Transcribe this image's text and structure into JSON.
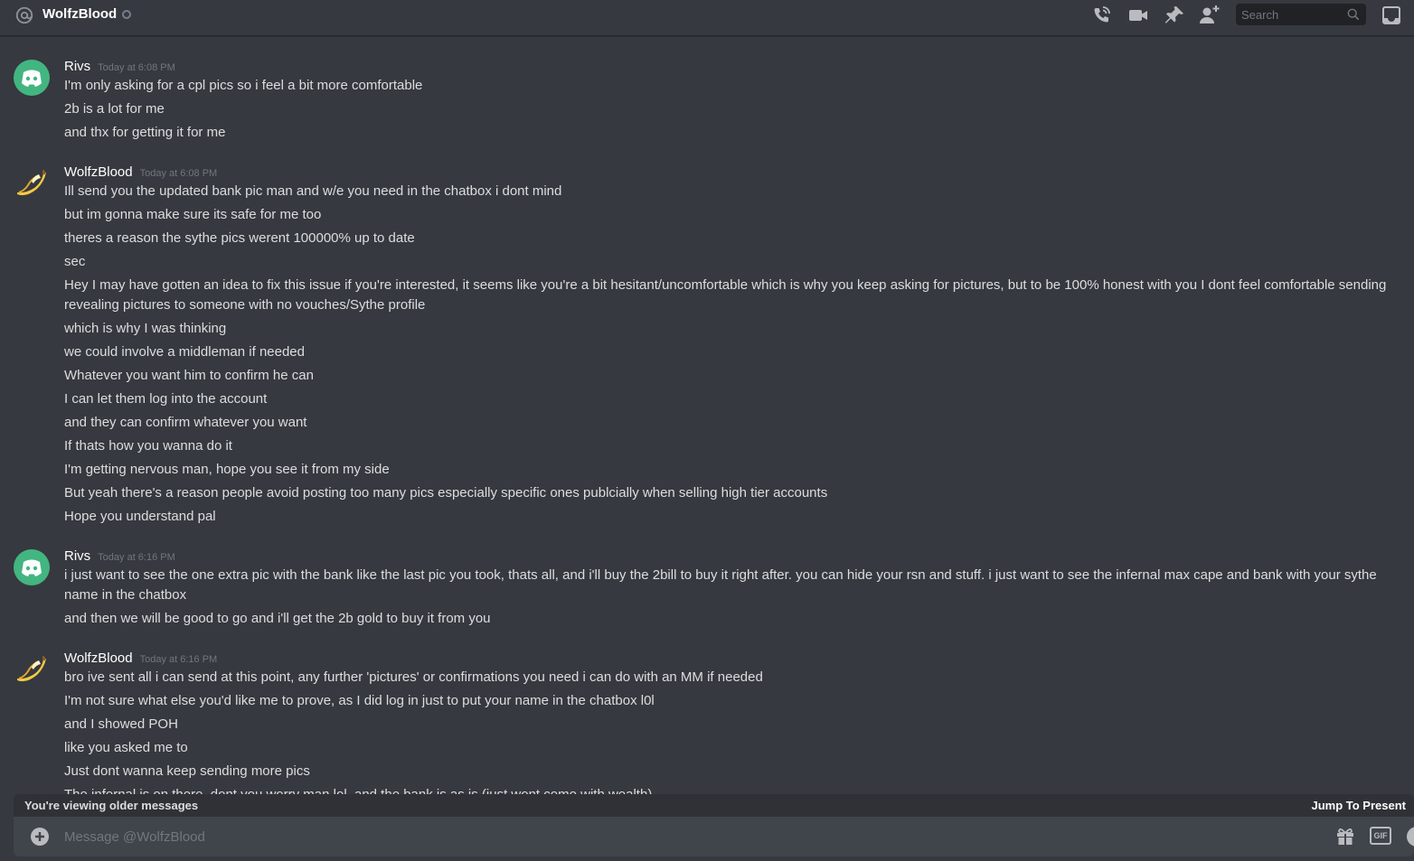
{
  "header": {
    "channel_name": "WolfzBlood",
    "search_placeholder": "Search"
  },
  "messages": [
    {
      "author": "Rivs",
      "timestamp": "Today at 6:08 PM",
      "avatar": "discord-logo-icon",
      "lines": [
        "I'm only asking for a cpl pics so i feel a bit more comfortable",
        "2b is a lot for me",
        "and thx for getting it for me"
      ]
    },
    {
      "author": "WolfzBlood",
      "timestamp": "Today at 6:08 PM",
      "avatar": "banana-icon",
      "lines": [
        "Ill send you the updated bank pic man and w/e you need in the chatbox i dont mind",
        "but im gonna make sure its safe for me too",
        "theres a reason the sythe pics werent 100000% up to date",
        "sec",
        "Hey I may have gotten an idea to fix this issue if you're interested, it seems like you're a bit hesitant/uncomfortable which is why you keep asking for pictures, but to be 100% honest with you I dont feel comfortable sending revealing pictures to someone with no vouches/Sythe profile",
        "which is why I was thinking",
        "we could involve a middleman if needed",
        "Whatever you want him to confirm he can",
        "I can let them log into the account",
        "and they can confirm whatever you want",
        "If thats how you wanna do it",
        "I'm getting nervous man, hope you see it from my side",
        "But yeah there's a reason people avoid posting too many pics especially specific ones publcially when selling high tier accounts",
        "Hope you understand pal"
      ]
    },
    {
      "author": "Rivs",
      "timestamp": "Today at 6:16 PM",
      "avatar": "discord-logo-icon",
      "lines": [
        "i just want to see the one extra pic with the bank like the last pic you took, thats all, and i'll buy the 2bill to buy it right after. you can hide your rsn and stuff. i just want to see the infernal max cape and bank with your sythe name in the chatbox",
        "and then we will be good to go and i'll get the 2b gold to buy it from you"
      ]
    },
    {
      "author": "WolfzBlood",
      "timestamp": "Today at 6:16 PM",
      "avatar": "banana-icon",
      "lines": [
        "bro ive sent all i can send at this point, any further 'pictures' or confirmations you need i can do with an MM if needed",
        "I'm not sure what else you'd like me to prove, as I did log in just to put your name in the chatbox l0l",
        "and I showed POH",
        "like you asked me to",
        "Just dont wanna keep sending more pics",
        "The infernal is on there, dont you worry man lol, and the bank is as is (just wont come with wealth)"
      ]
    }
  ],
  "older_bar": {
    "text": "You're viewing older messages",
    "jump": "Jump To Present"
  },
  "composer": {
    "placeholder": "Message @WolfzBlood",
    "gif_label": "GIF"
  }
}
